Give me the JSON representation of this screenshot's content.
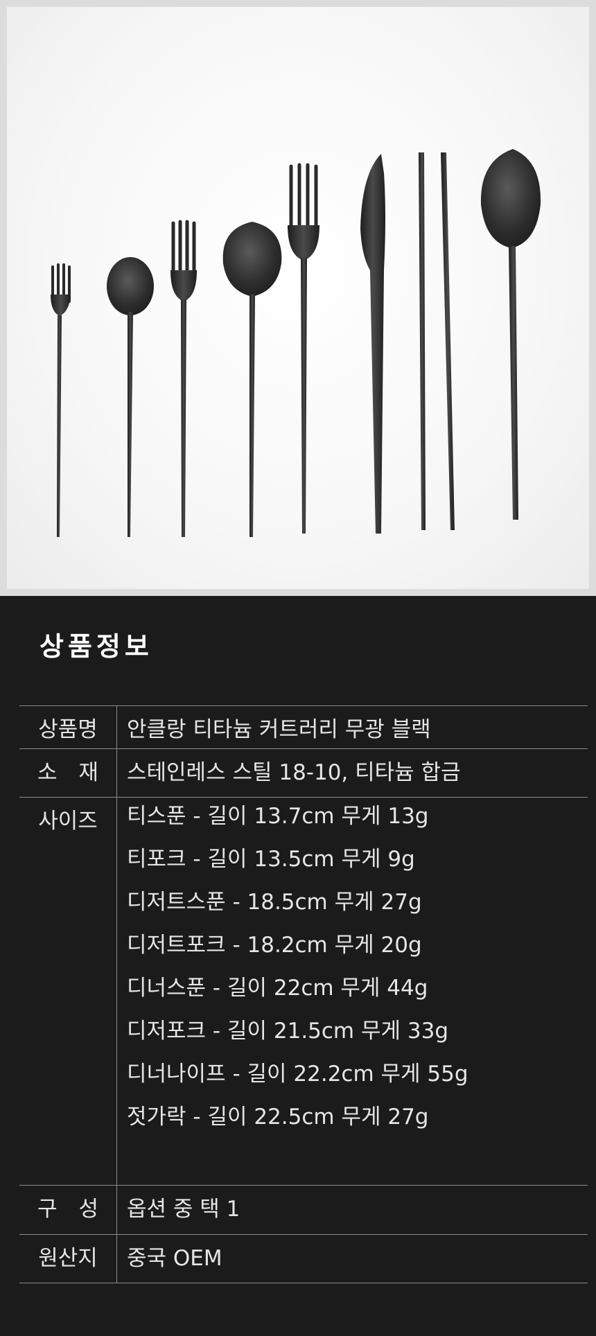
{
  "product_photo": {
    "utensils": [
      "fork-icon",
      "spoon-icon",
      "fork-icon",
      "spoon-icon",
      "fork-icon",
      "knife-icon",
      "chopsticks-icon",
      "spoon-icon"
    ],
    "color": "#2a2a2a"
  },
  "info": {
    "section_title": "상품정보",
    "rows": [
      {
        "label": "상품명",
        "value": "안클랑 티타늄 커트러리 무광 블랙"
      },
      {
        "label": "소　재",
        "value": "스테인레스 스틸 18-10, 티타늄 합금"
      }
    ],
    "sizes": {
      "label": "사이즈",
      "items": [
        "티스푼 - 길이 13.7cm 무게 13g",
        "티포크 - 길이 13.5cm 무게 9g",
        "디저트스푼 - 18.5cm 무게 27g",
        "디저트포크 - 18.2cm 무게 20g",
        "디너스푼 - 길이 22cm 무게 44g",
        "디저포크 - 길이 21.5cm 무게 33g",
        "디너나이프 - 길이 22.2cm 무게 55g",
        "젓가락 - 길이 22.5cm 무게 27g"
      ]
    },
    "composition": {
      "label": "구　성",
      "value": "옵션 중 택 1"
    },
    "origin": {
      "label": "원산지",
      "value": "중국 OEM"
    }
  }
}
